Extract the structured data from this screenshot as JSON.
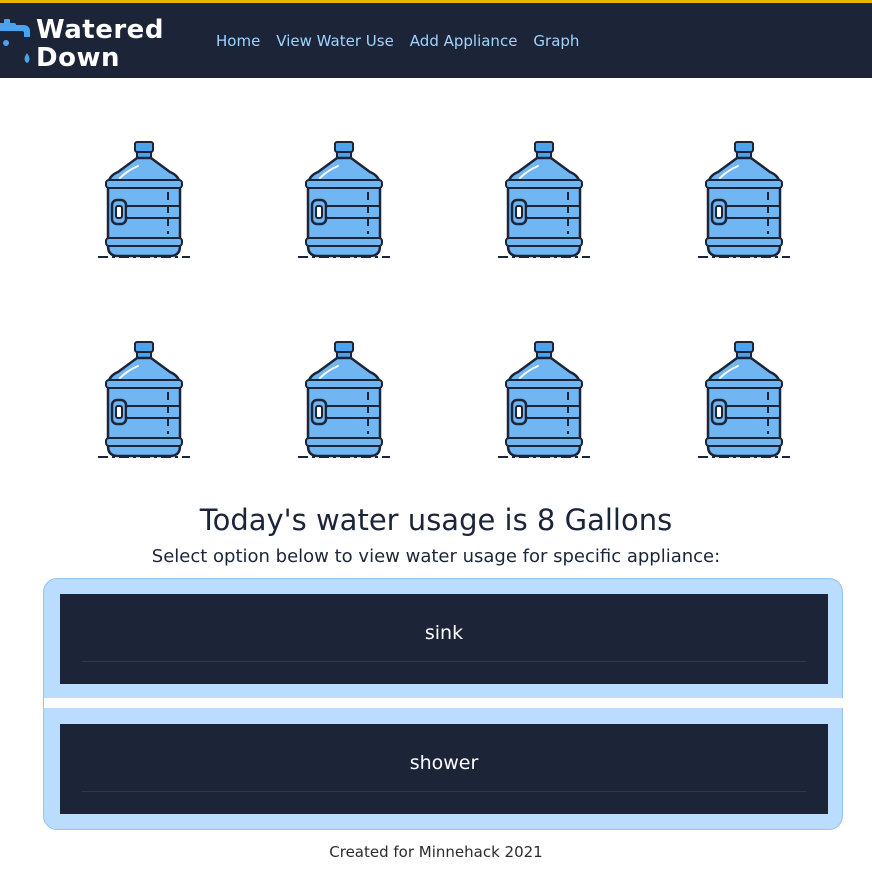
{
  "brand": {
    "line1": "Watered",
    "line2": "Down"
  },
  "nav": {
    "items": [
      "Home",
      "View Water Use",
      "Add Appliance",
      "Graph"
    ]
  },
  "usage": {
    "gallons": 8,
    "title": "Today's water usage is 8 Gallons",
    "subtitle": "Select option below to view water usage for specific appliance:"
  },
  "appliances": [
    {
      "label": "sink"
    },
    {
      "label": "shower"
    }
  ],
  "footer": {
    "text": "Created for Minnehack 2021"
  },
  "icons": {
    "logo": "faucet-drop-icon",
    "bottle": "water-jug-icon"
  },
  "colors": {
    "nav_bg": "#1c2438",
    "nav_link": "#9fd4ff",
    "accent_top": "#e8b800",
    "panel_bg": "#b9dcff",
    "bottle_fill": "#6fb6f2",
    "bottle_cap": "#4aa3ee"
  }
}
